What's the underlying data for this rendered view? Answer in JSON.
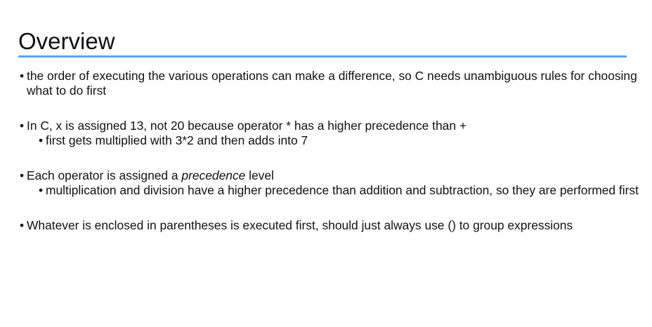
{
  "slide": {
    "title": "Overview",
    "bullets": [
      {
        "text": "the order of executing the various operations can make a difference, so C needs unambiguous rules for choosing what to do first"
      },
      {
        "text": "In C, x is assigned 13, not 20 because operator * has a higher precedence than +",
        "sub": "first gets multiplied with 3*2 and then adds into 7"
      },
      {
        "text_before": "Each operator is assigned a ",
        "text_em": "precedence",
        "text_after": " level",
        "sub": "multiplication and division have a higher precedence than addition and subtraction, so they are performed first"
      },
      {
        "text": "Whatever is enclosed in parentheses is executed first, should just always use () to group expressions"
      }
    ]
  },
  "colors": {
    "accent_rule": "#5aa5ec",
    "text": "#111111",
    "background": "#ffffff"
  }
}
